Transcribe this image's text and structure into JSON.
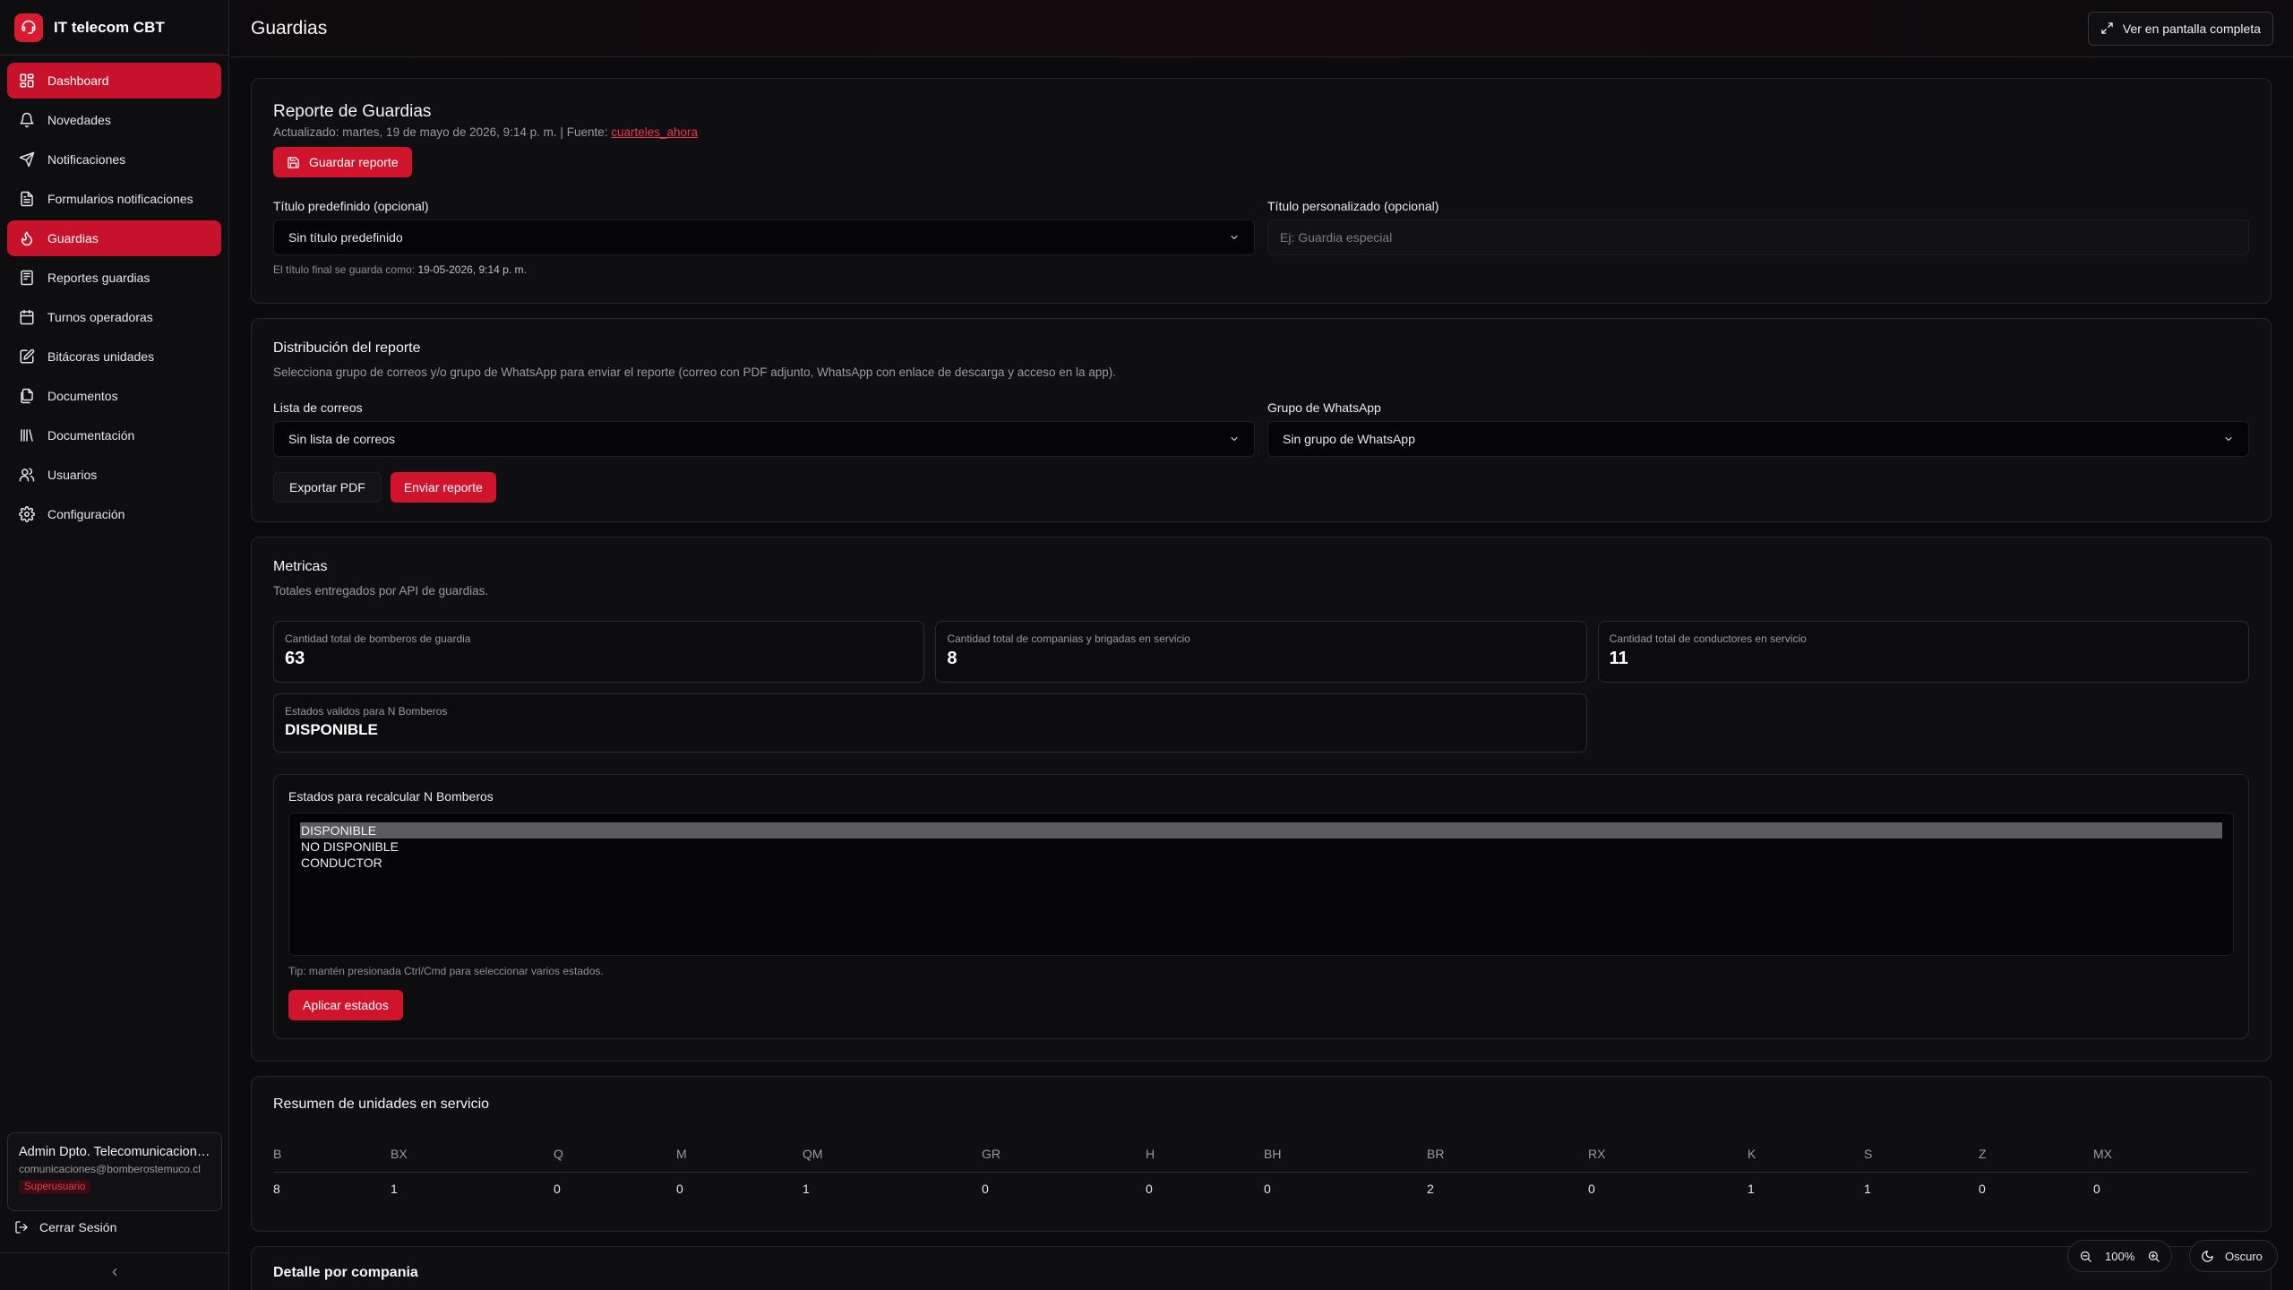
{
  "app": {
    "title": "IT telecom CBT"
  },
  "nav": [
    {
      "label": "Dashboard",
      "icon": "dashboard-icon"
    },
    {
      "label": "Novedades",
      "icon": "bell-icon"
    },
    {
      "label": "Notificaciones",
      "icon": "send-icon"
    },
    {
      "label": "Formularios notificaciones",
      "icon": "file-text-icon"
    },
    {
      "label": "Guardias",
      "icon": "flame-icon"
    },
    {
      "label": "Reportes guardias",
      "icon": "report-icon"
    },
    {
      "label": "Turnos operadoras",
      "icon": "calendar-icon"
    },
    {
      "label": "Bitácoras unidades",
      "icon": "edit-icon"
    },
    {
      "label": "Documentos",
      "icon": "files-icon"
    },
    {
      "label": "Documentación",
      "icon": "library-icon"
    },
    {
      "label": "Usuarios",
      "icon": "users-icon"
    },
    {
      "label": "Configuración",
      "icon": "gear-icon"
    }
  ],
  "user": {
    "name": "Admin Dpto. Telecomunicaciones",
    "email": "comunicaciones@bomberostemuco.cl",
    "role": "Superusuario"
  },
  "sidebar": {
    "logout": "Cerrar Sesión"
  },
  "header": {
    "title": "Guardias",
    "fullscreen": "Ver en pantalla completa"
  },
  "report": {
    "title": "Reporte de Guardias",
    "updated_prefix": "Actualizado: martes, 19 de mayo de 2026, 9:14 p. m. | Fuente:",
    "source": "cuarteles_ahora",
    "save_button": "Guardar reporte",
    "predef_label": "Título predefinido (opcional)",
    "predef_value": "Sin título predefinido",
    "custom_label": "Título personalizado (opcional)",
    "custom_placeholder": "Ej: Guardia especial",
    "final_hint_prefix": "El título final se guarda como:",
    "final_hint_value": "19-05-2026, 9:14 p. m."
  },
  "distribution": {
    "title": "Distribución del reporte",
    "description": "Selecciona grupo de correos y/o grupo de WhatsApp para enviar el reporte (correo con PDF adjunto, WhatsApp con enlace de descarga y acceso en la app).",
    "email_label": "Lista de correos",
    "email_value": "Sin lista de correos",
    "whatsapp_label": "Grupo de WhatsApp",
    "whatsapp_value": "Sin grupo de WhatsApp",
    "export_button": "Exportar PDF",
    "send_button": "Enviar reporte"
  },
  "metrics": {
    "title": "Metricas",
    "subtitle": "Totales entregados por API de guardias.",
    "items": [
      {
        "label": "Cantidad total de bomberos de guardia",
        "value": "63"
      },
      {
        "label": "Cantidad total de companias y brigadas en servicio",
        "value": "8"
      },
      {
        "label": "Cantidad total de conductores en servicio",
        "value": "11"
      }
    ],
    "states_label": "Estados validos para N Bomberos",
    "states_value": "DISPONIBLE",
    "recalc_title": "Estados para recalcular N Bomberos",
    "options": [
      "DISPONIBLE",
      "NO DISPONIBLE",
      "CONDUCTOR"
    ],
    "selected_option": "DISPONIBLE",
    "tip": "Tip: mantén presionada Ctrl/Cmd para seleccionar varios estados.",
    "apply_button": "Aplicar estados"
  },
  "units": {
    "title": "Resumen de unidades en servicio",
    "headers": [
      "B",
      "BX",
      "Q",
      "M",
      "QM",
      "GR",
      "H",
      "BH",
      "BR",
      "RX",
      "K",
      "S",
      "Z",
      "MX"
    ],
    "values": [
      "8",
      "1",
      "0",
      "0",
      "1",
      "0",
      "0",
      "0",
      "2",
      "0",
      "1",
      "1",
      "0",
      "0"
    ]
  },
  "detail": {
    "title": "Detalle por compania"
  },
  "controls": {
    "zoom": "100%",
    "theme": "Oscuro"
  },
  "colors": {
    "accent": "#d0142c",
    "background": "#0b0b0e",
    "card": "#0f0f13"
  }
}
